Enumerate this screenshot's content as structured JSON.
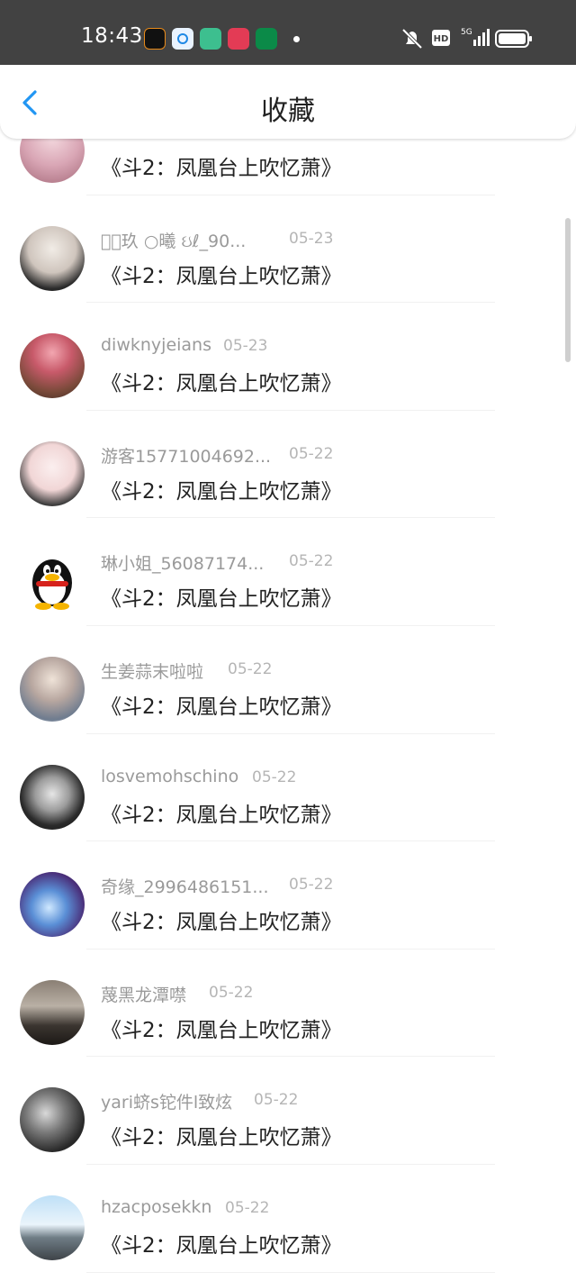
{
  "status_bar": {
    "time": "18:43"
  },
  "header": {
    "title": "收藏"
  },
  "book_title": "《斗2：凤凰台上吹忆萧》",
  "items": [
    {
      "username": "",
      "date": ""
    },
    {
      "username": "𝓜ꦿ玖 ○曦 ઇℓ_90...",
      "date": "05-23"
    },
    {
      "username": "diwknyjeians",
      "date": "05-23"
    },
    {
      "username": "游客15771004692...",
      "date": "05-22"
    },
    {
      "username": "琳小姐_56087174...",
      "date": "05-22"
    },
    {
      "username": "生姜蒜末啦啦",
      "date": "05-22"
    },
    {
      "username": "losvemohschino",
      "date": "05-22"
    },
    {
      "username": "奇缘_2996486151...",
      "date": "05-22"
    },
    {
      "username": "蔑黑龙潭噤",
      "date": "05-22"
    },
    {
      "username": "yari蛴s铊件l致炫",
      "date": "05-22"
    },
    {
      "username": "hzacposekkn",
      "date": "05-22"
    }
  ],
  "colors": {
    "accent": "#2196F3",
    "status_bar": "#424242"
  }
}
